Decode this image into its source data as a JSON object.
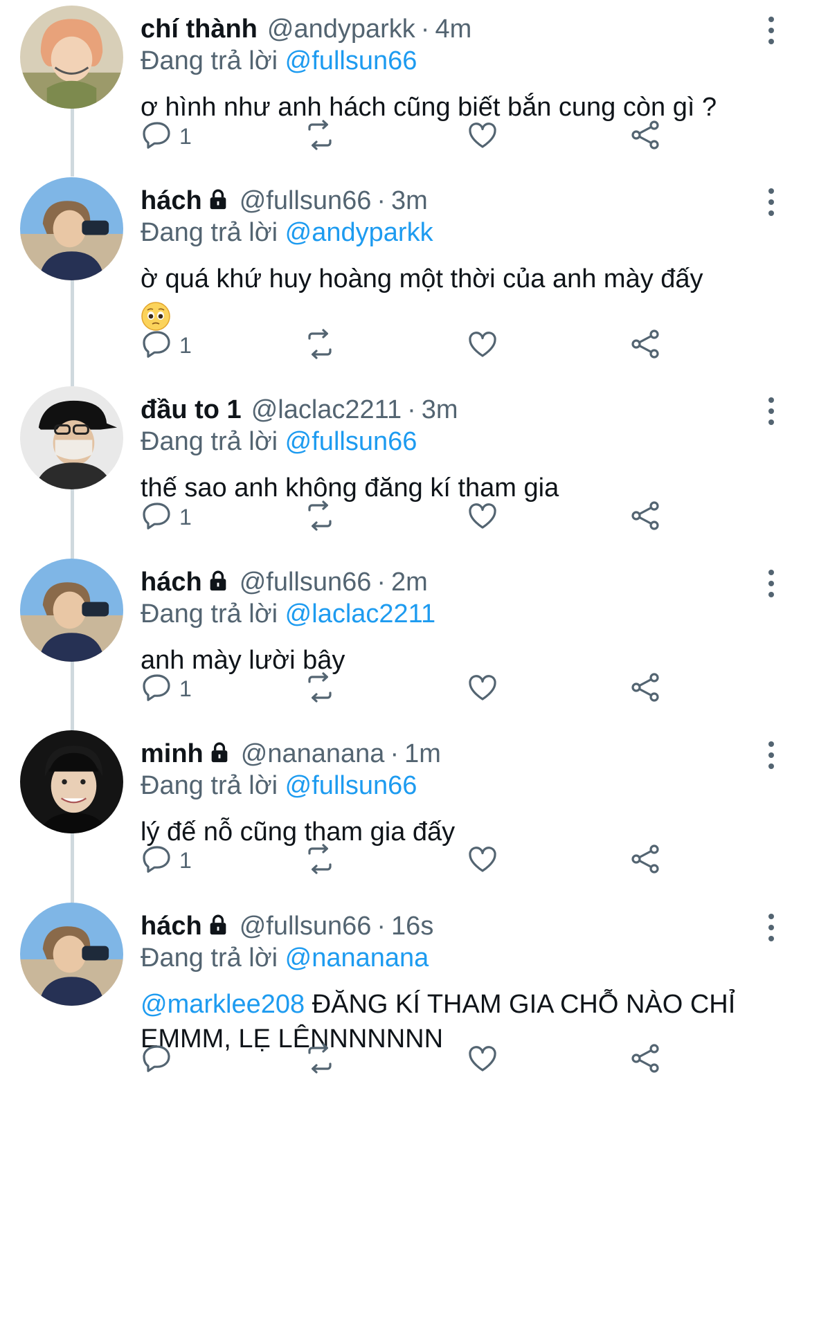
{
  "replying_label": "Đang trả lời",
  "tweets": [
    {
      "name": "chí thành",
      "handle": "@andyparkk",
      "time": "4m",
      "locked": false,
      "replying_to": "@fullsun66",
      "text": "ơ hình như anh hách cũng biết bắn cung còn gì ?",
      "reply_count": "1",
      "avatar": "orange-hair-avatar"
    },
    {
      "name": "hách",
      "handle": "@fullsun66",
      "time": "3m",
      "locked": true,
      "replying_to": "@andyparkk",
      "text": "ờ quá khứ huy hoàng một thời của anh mày đấy",
      "emoji": "pleading-face",
      "reply_count": "1",
      "avatar": "binoculars-beach-avatar"
    },
    {
      "name": "đầu to 1",
      "handle": "@laclac2211",
      "time": "3m",
      "locked": false,
      "replying_to": "@fullsun66",
      "text": "thế sao anh không đăng kí tham gia",
      "reply_count": "1",
      "avatar": "masked-cap-avatar"
    },
    {
      "name": "hách",
      "handle": "@fullsun66",
      "time": "2m",
      "locked": true,
      "replying_to": "@laclac2211",
      "text": "anh mày lười bây",
      "reply_count": "1",
      "avatar": "binoculars-beach-avatar"
    },
    {
      "name": "minh",
      "handle": "@nananana",
      "time": "1m",
      "locked": true,
      "replying_to": "@fullsun66",
      "text": "lý đế nỗ cũng tham gia đấy",
      "reply_count": "1",
      "avatar": "smiling-portrait-avatar"
    },
    {
      "name": "hách",
      "handle": "@fullsun66",
      "time": "16s",
      "locked": true,
      "replying_to": "@nananana",
      "text_mention": "@marklee208",
      "text": " ĐĂNG KÍ THAM GIA CHỖ NÀO CHỈ EMMM, LẸ LÊNNNNNNN",
      "reply_count": "",
      "avatar": "binoculars-beach-avatar"
    }
  ],
  "colors": {
    "link": "#1d9bf0",
    "secondary": "#536471",
    "text": "#0f1419",
    "thread": "#cfd9de"
  },
  "icons": [
    "reply-icon",
    "retweet-icon",
    "like-icon",
    "share-icon",
    "more-options-icon",
    "lock-icon"
  ]
}
